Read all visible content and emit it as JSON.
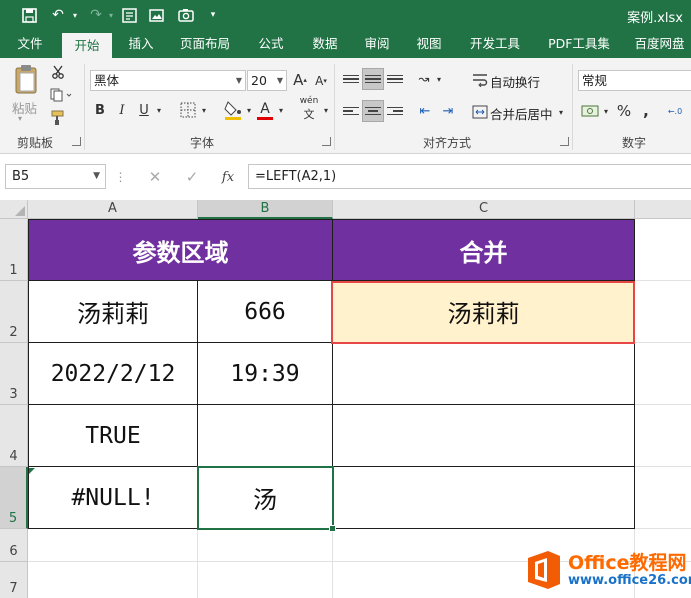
{
  "app": {
    "file_name": "案例.xlsx"
  },
  "ribbon_tabs": [
    "文件",
    "开始",
    "插入",
    "页面布局",
    "公式",
    "数据",
    "审阅",
    "视图",
    "开发工具",
    "PDF工具集",
    "百度网盘"
  ],
  "active_tab": "开始",
  "ribbon": {
    "clipboard": {
      "paste_label": "粘贴",
      "group_label": "剪贴板"
    },
    "font": {
      "name": "黑体",
      "size": "20",
      "bold": "B",
      "italic": "I",
      "underline": "U",
      "font_color_glyph": "A",
      "phonetic": "wén",
      "group_label": "字体"
    },
    "alignment": {
      "wrap_text": "自动换行",
      "merge_center": "合并后居中",
      "group_label": "对齐方式"
    },
    "number": {
      "format": "常规",
      "group_label": "数字"
    }
  },
  "formula_bar": {
    "name_box": "B5",
    "formula": "=LEFT(A2,1)",
    "fx_label": "fx"
  },
  "columns": [
    "A",
    "B",
    "C"
  ],
  "rows": [
    "1",
    "2",
    "3",
    "4",
    "5",
    "6",
    "7"
  ],
  "selected_cell": "B5",
  "cells": {
    "A1": "参数区域",
    "C1": "合并",
    "A2": "汤莉莉",
    "B2": "666",
    "C2": "汤莉莉",
    "A3": "2022/2/12",
    "B3": "19:39",
    "C3": "",
    "A4": "TRUE",
    "B4": "",
    "C4": "",
    "A5": "#NULL!",
    "B5": "汤",
    "C5": ""
  },
  "colors": {
    "excel_green": "#217346",
    "header_purple": "#7030a0",
    "result_fill": "#fff2cc",
    "highlight_red": "#e64646"
  },
  "watermark": {
    "brand": "Office教程网",
    "url": "www.office26.com"
  }
}
